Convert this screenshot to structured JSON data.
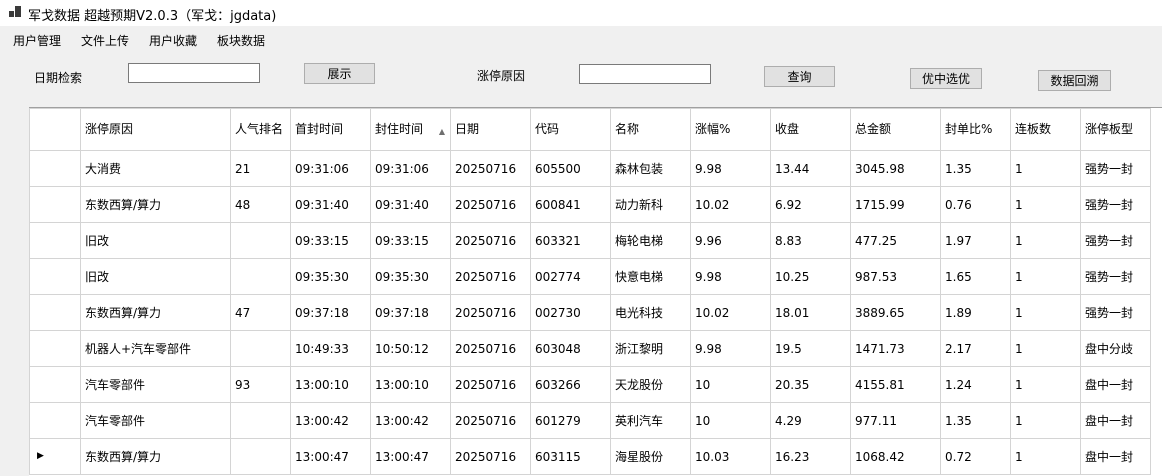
{
  "window": {
    "title": "军戈数据 超越预期V2.0.3（军戈：jgdata)"
  },
  "menu": [
    "用户管理",
    "文件上传",
    "用户收藏",
    "板块数据"
  ],
  "search": {
    "date_label": "日期检索",
    "date_value": "",
    "show_button": "展示",
    "reason_label": "涨停原因",
    "reason_value": "",
    "query_button": "查询",
    "best_button": "优中选优",
    "backtrack_button": "数据回溯"
  },
  "grid": {
    "sorted_column": 3,
    "sort_direction": "ascending",
    "current_row": 8,
    "columns": [
      "涨停原因",
      "人气排名",
      "首封时间",
      "封住时间",
      "日期",
      "代码",
      "名称",
      "涨幅%",
      "收盘",
      "总金额",
      "封单比%",
      "连板数",
      "涨停板型"
    ],
    "rows": [
      [
        "大消费",
        "21",
        "09:31:06",
        "09:31:06",
        "20250716",
        "605500",
        "森林包装",
        "9.98",
        "13.44",
        "3045.98",
        "1.35",
        "1",
        "强势一封"
      ],
      [
        "东数西算/算力",
        "48",
        "09:31:40",
        "09:31:40",
        "20250716",
        "600841",
        "动力新科",
        "10.02",
        "6.92",
        "1715.99",
        "0.76",
        "1",
        "强势一封"
      ],
      [
        "旧改",
        "",
        "09:33:15",
        "09:33:15",
        "20250716",
        "603321",
        "梅轮电梯",
        "9.96",
        "8.83",
        "477.25",
        "1.97",
        "1",
        "强势一封"
      ],
      [
        "旧改",
        "",
        "09:35:30",
        "09:35:30",
        "20250716",
        "002774",
        "快意电梯",
        "9.98",
        "10.25",
        "987.53",
        "1.65",
        "1",
        "强势一封"
      ],
      [
        "东数西算/算力",
        "47",
        "09:37:18",
        "09:37:18",
        "20250716",
        "002730",
        "电光科技",
        "10.02",
        "18.01",
        "3889.65",
        "1.89",
        "1",
        "强势一封"
      ],
      [
        "机器人+汽车零部件",
        "",
        "10:49:33",
        "10:50:12",
        "20250716",
        "603048",
        "浙江黎明",
        "9.98",
        "19.5",
        "1471.73",
        "2.17",
        "1",
        "盘中分歧"
      ],
      [
        "汽车零部件",
        "93",
        "13:00:10",
        "13:00:10",
        "20250716",
        "603266",
        "天龙股份",
        "10",
        "20.35",
        "4155.81",
        "1.24",
        "1",
        "盘中一封"
      ],
      [
        "汽车零部件",
        "",
        "13:00:42",
        "13:00:42",
        "20250716",
        "601279",
        "英利汽车",
        "10",
        "4.29",
        "977.11",
        "1.35",
        "1",
        "盘中一封"
      ],
      [
        "东数西算/算力",
        "",
        "13:00:47",
        "13:00:47",
        "20250716",
        "603115",
        "海星股份",
        "10.03",
        "16.23",
        "1068.42",
        "0.72",
        "1",
        "盘中一封"
      ]
    ]
  }
}
